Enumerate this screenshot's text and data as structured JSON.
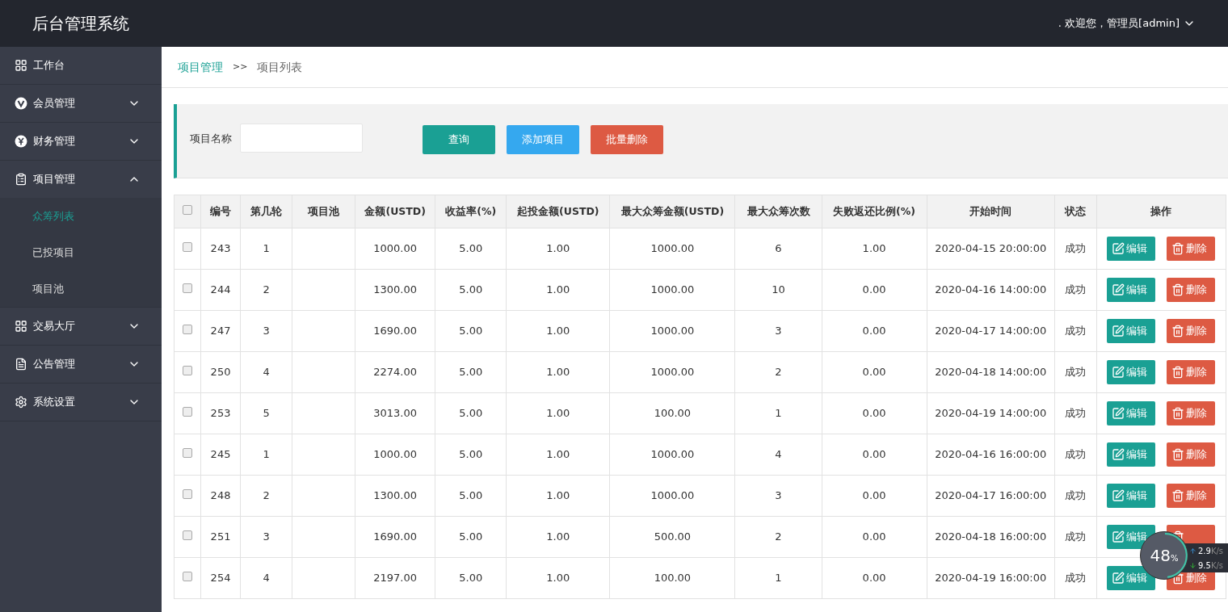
{
  "header": {
    "title": "后台管理系统",
    "user": ". 欢迎您，管理员[admin]"
  },
  "sidebar": {
    "items": [
      {
        "label": "工作台"
      },
      {
        "label": "会员管理",
        "expanded": false
      },
      {
        "label": "财务管理",
        "expanded": false
      },
      {
        "label": "项目管理",
        "expanded": true,
        "children": [
          {
            "label": "众筹列表",
            "selected": true
          },
          {
            "label": "已投项目",
            "selected": false
          },
          {
            "label": "项目池",
            "selected": false
          }
        ]
      },
      {
        "label": "交易大厅",
        "expanded": false
      },
      {
        "label": "公告管理",
        "expanded": false
      },
      {
        "label": "系统设置",
        "expanded": false
      }
    ]
  },
  "breadcrumb": {
    "parent": "项目管理",
    "separator": ">>",
    "current": "项目列表"
  },
  "filter": {
    "label": "项目名称",
    "buttons": [
      {
        "label": "查询",
        "kind": "primary"
      },
      {
        "label": "添加项目",
        "kind": "info"
      },
      {
        "label": "批量删除",
        "kind": "danger"
      }
    ]
  },
  "table": {
    "columns": [
      "编号",
      "第几轮",
      "项目池",
      "金额(USTD)",
      "收益率(%)",
      "起投金额(USTD)",
      "最大众筹金额(USTD)",
      "最大众筹次数",
      "失败返还比例(%)",
      "开始时间",
      "状态",
      "操作"
    ],
    "select_all_checked": false,
    "rows": [
      {
        "checked": false,
        "cells": [
          "243",
          "1",
          "",
          "1000.00",
          "5.00",
          "1.00",
          "1000.00",
          "6",
          "1.00",
          "2020-04-15 20:00:00",
          "成功"
        ],
        "edit": "编辑",
        "delete": "删除"
      },
      {
        "checked": false,
        "cells": [
          "244",
          "2",
          "",
          "1300.00",
          "5.00",
          "1.00",
          "1000.00",
          "10",
          "0.00",
          "2020-04-16 14:00:00",
          "成功"
        ],
        "edit": "编辑",
        "delete": "删除"
      },
      {
        "checked": false,
        "cells": [
          "247",
          "3",
          "",
          "1690.00",
          "5.00",
          "1.00",
          "1000.00",
          "3",
          "0.00",
          "2020-04-17 14:00:00",
          "成功"
        ],
        "edit": "编辑",
        "delete": "删除"
      },
      {
        "checked": false,
        "cells": [
          "250",
          "4",
          "",
          "2274.00",
          "5.00",
          "1.00",
          "1000.00",
          "2",
          "0.00",
          "2020-04-18 14:00:00",
          "成功"
        ],
        "edit": "编辑",
        "delete": "删除"
      },
      {
        "checked": false,
        "cells": [
          "253",
          "5",
          "",
          "3013.00",
          "5.00",
          "1.00",
          "100.00",
          "1",
          "0.00",
          "2020-04-19 14:00:00",
          "成功"
        ],
        "edit": "编辑",
        "delete": "删除"
      },
      {
        "checked": false,
        "cells": [
          "245",
          "1",
          "",
          "1000.00",
          "5.00",
          "1.00",
          "1000.00",
          "4",
          "0.00",
          "2020-04-16 16:00:00",
          "成功"
        ],
        "edit": "编辑",
        "delete": "删除"
      },
      {
        "checked": false,
        "cells": [
          "248",
          "2",
          "",
          "1300.00",
          "5.00",
          "1.00",
          "1000.00",
          "3",
          "0.00",
          "2020-04-17 16:00:00",
          "成功"
        ],
        "edit": "编辑",
        "delete": "删除"
      },
      {
        "checked": false,
        "cells": [
          "251",
          "3",
          "",
          "1690.00",
          "5.00",
          "1.00",
          "500.00",
          "2",
          "0.00",
          "2020-04-18 16:00:00",
          "成功"
        ],
        "edit": "编辑"
      },
      {
        "checked": false,
        "cells": [
          "254",
          "4",
          "",
          "2197.00",
          "5.00",
          "1.00",
          "100.00",
          "1",
          "0.00",
          "2020-04-19 16:00:00",
          "成功"
        ],
        "edit": "编辑",
        "delete": "删除"
      }
    ]
  },
  "speed_widget": {
    "percent": "48",
    "unit": "%",
    "upload": "2.9",
    "upload_unit": "K/s",
    "download": "9.5",
    "download_unit": "K/s"
  }
}
